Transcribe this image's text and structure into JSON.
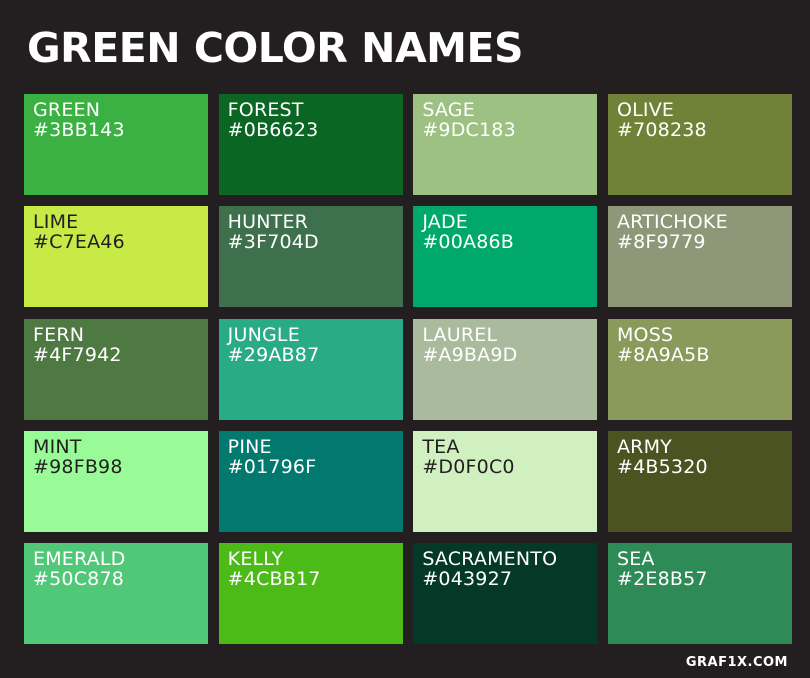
{
  "title": "GREEN COLOR NAMES",
  "credit": "GRAF1X.COM",
  "colors": {
    "background": "#231F20",
    "title_text": "#FFFFFF"
  },
  "swatches": [
    {
      "name": "GREEN",
      "hex": "#3BB143",
      "text_color": "light"
    },
    {
      "name": "FOREST",
      "hex": "#0B6623",
      "text_color": "light"
    },
    {
      "name": "SAGE",
      "hex": "#9DC183",
      "text_color": "light"
    },
    {
      "name": "OLIVE",
      "hex": "#708238",
      "text_color": "light"
    },
    {
      "name": "LIME",
      "hex": "#C7EA46",
      "text_color": "dark"
    },
    {
      "name": "HUNTER",
      "hex": "#3F704D",
      "text_color": "light"
    },
    {
      "name": "JADE",
      "hex": "#00A86B",
      "text_color": "light"
    },
    {
      "name": "ARTICHOKE",
      "hex": "#8F9779",
      "text_color": "light"
    },
    {
      "name": "FERN",
      "hex": "#4F7942",
      "text_color": "light"
    },
    {
      "name": "JUNGLE",
      "hex": "#29AB87",
      "text_color": "light"
    },
    {
      "name": "LAUREL",
      "hex": "#A9BA9D",
      "text_color": "light"
    },
    {
      "name": "MOSS",
      "hex": "#8A9A5B",
      "text_color": "light"
    },
    {
      "name": "MINT",
      "hex": "#98FB98",
      "text_color": "dark"
    },
    {
      "name": "PINE",
      "hex": "#01796F",
      "text_color": "light"
    },
    {
      "name": "TEA",
      "hex": "#D0F0C0",
      "text_color": "dark"
    },
    {
      "name": "ARMY",
      "hex": "#4B5320",
      "text_color": "light"
    },
    {
      "name": "EMERALD",
      "hex": "#50C878",
      "text_color": "light"
    },
    {
      "name": "KELLY",
      "hex": "#4CBB17",
      "text_color": "light"
    },
    {
      "name": "SACRAMENTO",
      "hex": "#043927",
      "text_color": "light"
    },
    {
      "name": "SEA",
      "hex": "#2E8B57",
      "text_color": "light"
    }
  ]
}
